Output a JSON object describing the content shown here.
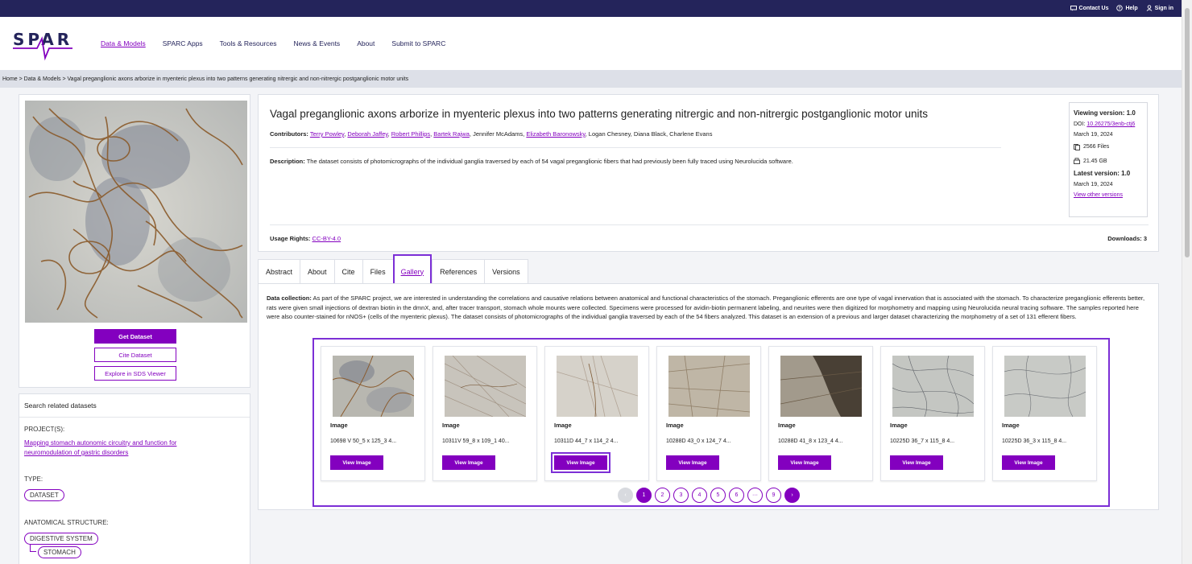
{
  "topbar": {
    "contact": "Contact Us",
    "help": "Help",
    "signin": "Sign in"
  },
  "logo": {
    "text": "SPARC"
  },
  "nav": {
    "items": [
      "Data & Models",
      "SPARC Apps",
      "Tools & Resources",
      "News & Events",
      "About",
      "Submit to SPARC"
    ]
  },
  "breadcrumb": "Home > Data & Models > Vagal preganglionic axons arborize in myenteric plexus into two patterns generating nitrergic and non-nitrergic postganglionic motor units",
  "left": {
    "get_dataset": "Get Dataset",
    "cite_dataset": "Cite Dataset",
    "explore": "Explore in SDS Viewer"
  },
  "related": {
    "heading": "Search related datasets",
    "project_label": "PROJECT(S):",
    "project_link": "Mapping stomach autonomic circuitry and function for neuromodulation of gastric disorders",
    "type_label": "TYPE:",
    "type_tag": "DATASET",
    "anat_label": "ANATOMICAL STRUCTURE:",
    "anat_tag1": "DIGESTIVE SYSTEM",
    "anat_tag2": "STOMACH"
  },
  "dataset": {
    "title": "Vagal preganglionic axons arborize in myenteric plexus into two patterns generating nitrergic and non-nitrergic postganglionic motor units",
    "contributors_label": "Contributors:",
    "contributors_linked": [
      "Terry Powley",
      "Deborah Jaffey",
      "Robert Phillips",
      "Bartek Rajwa"
    ],
    "contrib_mid": "Jennifer McAdams,",
    "contributor_linked2": "Elizabeth Baronowsky",
    "contrib_tail": ", Logan Chesney, Diana Black, Charlene Evans",
    "description_label": "Description:",
    "description": "The dataset consists of photomicrographs of the individual ganglia traversed by each of 54 vagal preganglionic fibers that had previously been fully traced using Neurolucida software.",
    "usage_label": "Usage Rights:",
    "usage_link": "CC-BY-4.0",
    "downloads": "Downloads: 3"
  },
  "version": {
    "viewing": "Viewing version: 1.0",
    "doi_label": "DOI:",
    "doi": "10.26275/3enb-ctj6",
    "date1": "March 19, 2024",
    "files": "2566 Files",
    "size": "21.45 GB",
    "latest": "Latest version: 1.0",
    "date2": "March 19, 2024",
    "other": "View other versions"
  },
  "tabs": [
    "Abstract",
    "About",
    "Cite",
    "Files",
    "Gallery",
    "References",
    "Versions"
  ],
  "collection": {
    "label": "Data collection:",
    "text": "As part of the SPARC project, we are interested in understanding the correlations and causative relations between anatomical and functional characteristics of the stomach. Preganglionic efferents are one type of vagal innervation that is associated with the stomach. To characterize preganglionic efferents better, rats were given small injections of dextran biotin in the dmnX, and, after tracer transport, stomach whole mounts were collected. Specimens were processed for avidin-biotin permanent labeling, and neurites were then digitized for morphometry and mapping using Neurolucida neural tracing software. The samples reported here were also counter-stained for nNOS+ (cells of the myenteric plexus). The dataset consists of photomicrographs of the individual ganglia traversed by each of the 54 fibers analyzed. This dataset is an extension of a previous and larger dataset characterizing the morphometry of a set of 131 efferent fibers."
  },
  "gallery": {
    "items": [
      {
        "type": "Image",
        "name": "10698 V 50_5 x 125_3 4...",
        "button": "View Image"
      },
      {
        "type": "Image",
        "name": "10311V 59_8 x 109_1 40...",
        "button": "View Image"
      },
      {
        "type": "Image",
        "name": "10311D 44_7 x 114_2 4...",
        "button": "View Image"
      },
      {
        "type": "Image",
        "name": "10288D 43_0 x 124_7 4...",
        "button": "View Image"
      },
      {
        "type": "Image",
        "name": "10288D 41_8 x 123_4 4...",
        "button": "View Image"
      },
      {
        "type": "Image",
        "name": "10225D 36_7 x 115_8 4...",
        "button": "View Image"
      },
      {
        "type": "Image",
        "name": "10225D 36_3 x 115_8 4...",
        "button": "View Image"
      }
    ],
    "pages": [
      "1",
      "2",
      "3",
      "4",
      "5",
      "6",
      "···",
      "9"
    ],
    "active_page": "1"
  },
  "colors": {
    "brand_purple": "#8300bf",
    "topbar": "#24245b",
    "highlight": "#7c2fd6"
  }
}
